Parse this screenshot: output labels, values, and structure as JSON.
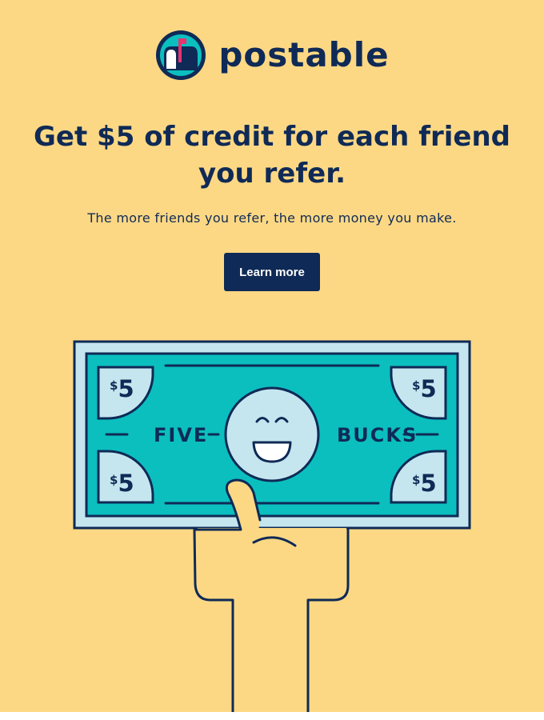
{
  "brand": {
    "name": "postable",
    "logo_icon": "mailbox-icon"
  },
  "headline": "Get $5 of credit for each friend you refer.",
  "subline": "The more friends you refer, the more money you make.",
  "cta": {
    "label": "Learn more"
  },
  "bill": {
    "left_word": "FIVE",
    "right_word": "BUCKS",
    "corner_sign": "$",
    "corner_amount": "5",
    "face_icon": "smiling-face-icon",
    "hand_icon": "hand-icon"
  },
  "colors": {
    "background": "#fdd884",
    "navy": "#0f2a56",
    "bill_teal": "#0bbfbf",
    "bill_light": "#c6e6ef",
    "mailbox_flag": "#e8336f",
    "hand": "#fdd884"
  }
}
